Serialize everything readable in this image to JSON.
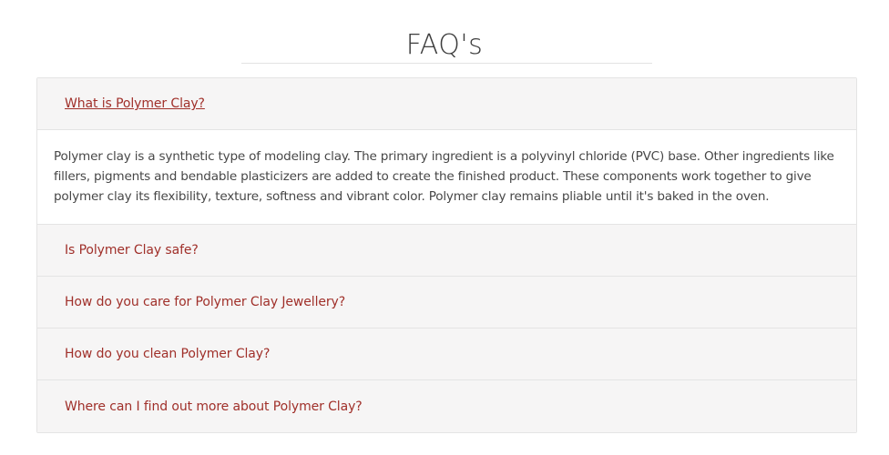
{
  "page": {
    "title": "FAQ's"
  },
  "colors": {
    "link": "#a0302a",
    "header_bg": "#f6f5f5",
    "border": "#e4e4e4",
    "body_text": "#474747"
  },
  "faq": {
    "items": [
      {
        "question": "What is Polymer Clay?",
        "expanded": true,
        "answer": "Polymer clay is a synthetic type of modeling clay. The primary ingredient is a polyvinyl chloride (PVC) base. Other ingredients like fillers, pigments and bendable plasticizers are added to create the finished product. These components work together to give polymer clay its flexibility, texture, softness and vibrant color. Polymer clay remains pliable until it's baked in the oven."
      },
      {
        "question": "Is Polymer Clay safe?",
        "expanded": false
      },
      {
        "question": "How do you care for Polymer Clay Jewellery?",
        "expanded": false
      },
      {
        "question": "How do you clean Polymer Clay?",
        "expanded": false
      },
      {
        "question": "Where can I find out more about Polymer Clay?",
        "expanded": false
      }
    ]
  }
}
